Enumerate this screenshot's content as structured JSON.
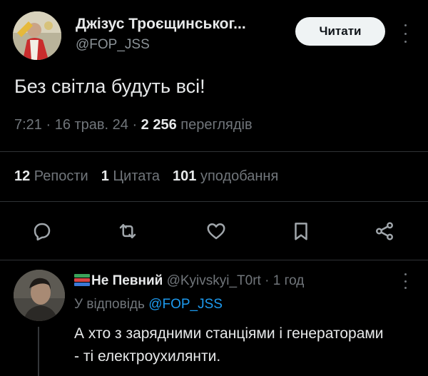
{
  "tweet": {
    "author_name": "Джізус Троєщинськог...",
    "author_handle": "@FOP_JSS",
    "follow_label": "Читати",
    "text": "Без світла будуть всі!",
    "time": "7:21 · 16 трав. 24 · ",
    "views_count": "2 256",
    "views_label": " переглядів",
    "reposts_count": "12",
    "reposts_label": " Репости",
    "quotes_count": "1",
    "quotes_label": " Цитата",
    "likes_count": "101",
    "likes_label": " уподобання"
  },
  "actions": {
    "reply_icon": "reply-icon",
    "repost_icon": "repost-icon",
    "like_icon": "heart-icon",
    "bookmark_icon": "bookmark-icon",
    "share_icon": "share-icon"
  },
  "reply": {
    "author_name": "Не Певний",
    "author_handle": " @Kyivskyi_T0rt",
    "time": " · 1 год",
    "replying_to_label": "У відповідь ",
    "replying_to_handle": "@FOP_JSS",
    "text": "А хто з зарядними станціями і генераторами - ті електроухилянти."
  },
  "colors": {
    "background": "#000000",
    "text": "#e7e9ea",
    "muted": "#71767b",
    "link": "#1d9bf0",
    "button_bg": "#eff3f4"
  }
}
